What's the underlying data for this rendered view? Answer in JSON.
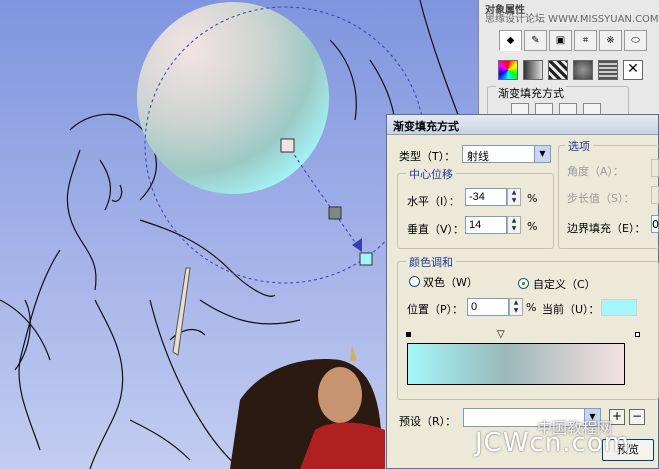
{
  "docker": {
    "title": "对象属性",
    "watermark": "思缘设计论坛 WWW.MISSYUAN.COM",
    "tabs": [
      "fill-bucket-icon",
      "pen-nib-icon",
      "frame-icon",
      "crop-icon",
      "pattern-icon",
      "ellipse-icon"
    ],
    "fill_types": [
      "uniform-fill-icon",
      "fountain-fill-icon",
      "pattern-fill-icon",
      "texture-fill-icon",
      "postscript-fill-icon",
      "no-fill-icon"
    ],
    "group_label": "渐变填充方式"
  },
  "dialog": {
    "title": "渐变填充方式",
    "type_label": "类型（T）：",
    "type_value": "射线",
    "options_legend": "选项",
    "angle_label": "角度（A）：",
    "steps_label": "步长值（S）：",
    "edge_pad_label": "边界填充（E）：",
    "edge_pad_value": "0",
    "center_legend": "中心位移",
    "horizontal_label": "水平（I）：",
    "horizontal_value": "-34",
    "vertical_label": "垂直（V）：",
    "vertical_value": "14",
    "percent": "%",
    "blend_legend": "颜色调和",
    "two_color_label": "双色（W）",
    "custom_label": "自定义（C）",
    "position_label": "位置（P）：",
    "position_value": "0",
    "current_label": "当前（U）：",
    "current_color": "#a3f7fa",
    "preset_label": "预设（R）：",
    "preset_value": "",
    "add_preset_symbol": "+",
    "remove_preset_symbol": "−",
    "preview_label": "预览"
  },
  "watermark": {
    "site": "JCWcn.com",
    "cn": "中国教程网"
  },
  "colors": {
    "gradient_start": "#a3f7fa",
    "gradient_end": "#f4e3e4",
    "canvas_top": "#7f95de",
    "canvas_bottom": "#c3cdf1"
  }
}
